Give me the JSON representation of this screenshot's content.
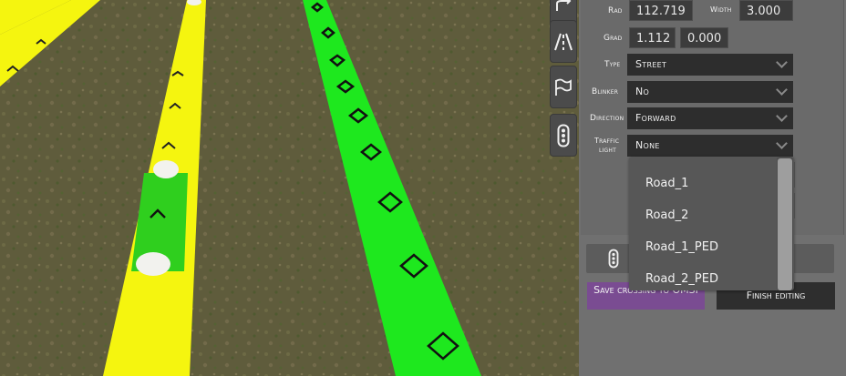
{
  "properties": {
    "rad_label": "Rad",
    "rad_value": "112.719",
    "width_label": "Width",
    "width_value": "3.000",
    "grad_label": "Grad",
    "grad_value_1": "1.112",
    "grad_value_2": "0.000",
    "type_label": "Type",
    "type_value": "Street",
    "blinker_label": "Blinker",
    "blinker_value": "No",
    "direction_label": "Direction",
    "direction_value": "Forward",
    "traffic_light_label_1": "Traffic",
    "traffic_light_label_2": "light",
    "traffic_light_value": "None"
  },
  "dropdown": {
    "options": [
      "Road_1",
      "Road_2",
      "Road_1_PED",
      "Road_2_PED"
    ]
  },
  "actions": {
    "save_label": "Save crossing to OMSI",
    "finish_label": "Finish editing"
  },
  "toolbar": {
    "icons": [
      "curve-tool-icon",
      "road-lanes-icon",
      "flag-icon",
      "traffic-light-icon"
    ]
  },
  "colors": {
    "green_lane": "#1ee81e",
    "yellow_lane": "#f5f50f",
    "save_button": "#7a4c92",
    "panel": "#707070"
  }
}
